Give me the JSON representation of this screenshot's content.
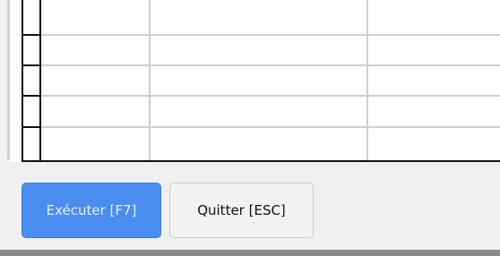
{
  "grid": {
    "rows": 5,
    "columns": 3
  },
  "buttons": {
    "run_label": "Exécuter [F7]",
    "quit_label": "Quitter [ESC]"
  },
  "colors": {
    "run_button": "#4a8df0",
    "quit_button": "#f2f2f2"
  }
}
